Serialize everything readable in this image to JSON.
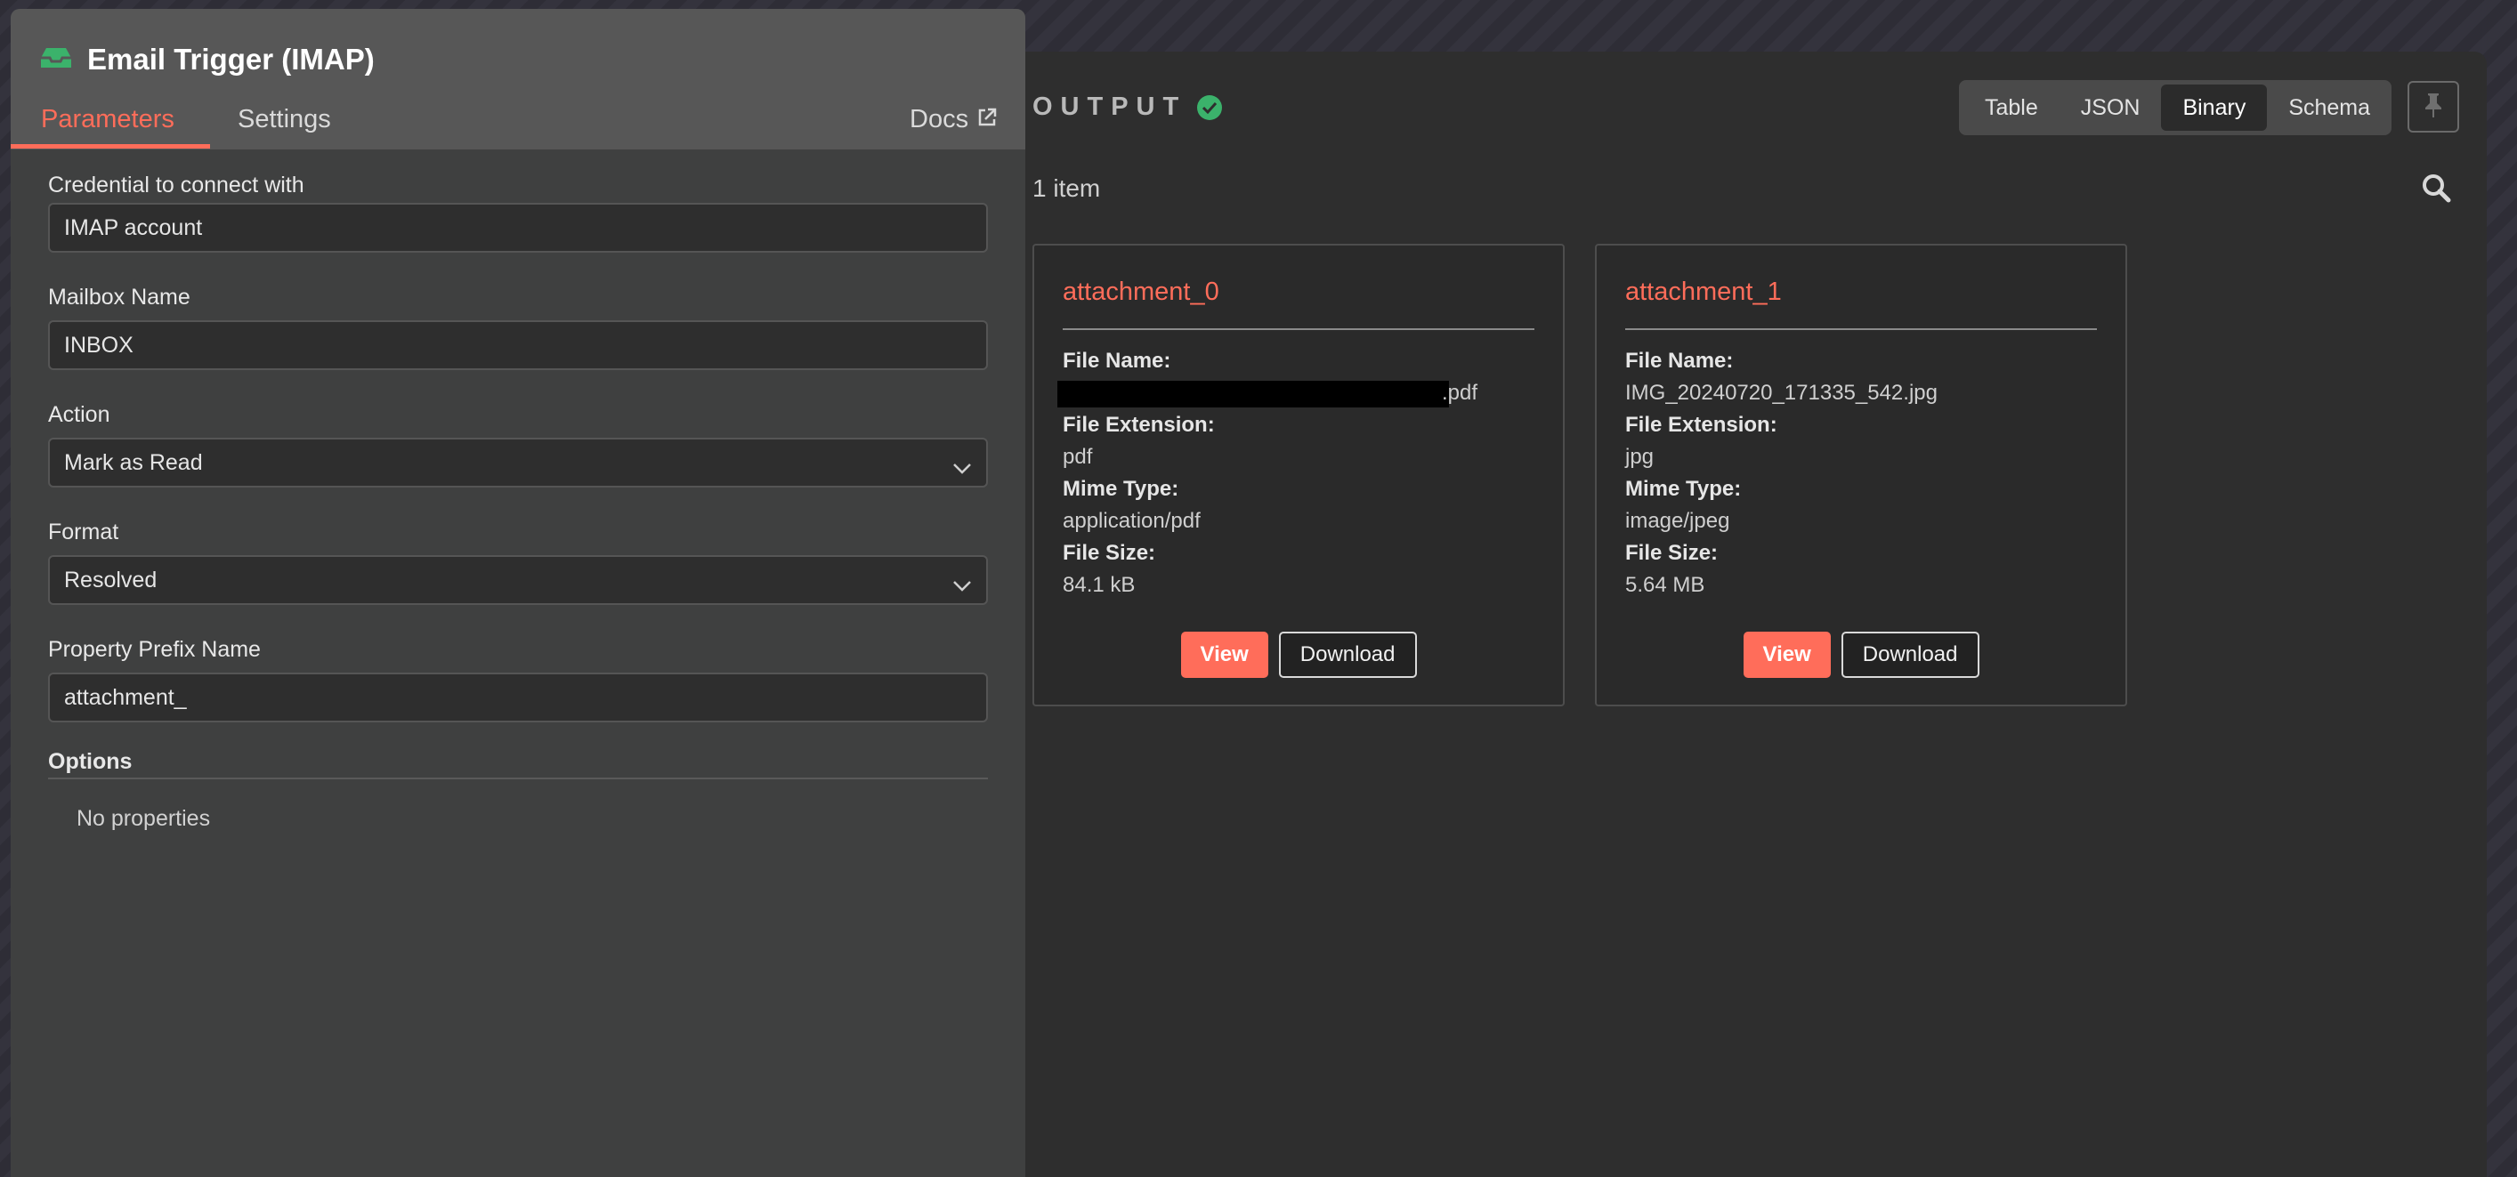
{
  "node": {
    "title": "Email Trigger (IMAP)",
    "tabs": [
      "Parameters",
      "Settings"
    ],
    "docs_label": "Docs",
    "icon": "inbox-icon",
    "fields": [
      {
        "label": "Credential to connect with",
        "value": "IMAP account"
      },
      {
        "label": "Mailbox Name",
        "value": "INBOX"
      },
      {
        "label": "Action",
        "value": "Mark as Read"
      },
      {
        "label": "Format",
        "value": "Resolved"
      },
      {
        "label": "Property Prefix Name",
        "value": "attachment_"
      }
    ],
    "options_label": "Options",
    "no_properties": "No properties"
  },
  "output": {
    "label": "OUTPUT",
    "view_tabs": [
      "Table",
      "JSON",
      "Binary",
      "Schema"
    ],
    "active_tab": "Binary",
    "item_count": "1 item",
    "labels": {
      "file_name": "File Name:",
      "file_extension": "File Extension:",
      "mime_type": "Mime Type:",
      "file_size": "File Size:",
      "view": "View",
      "download": "Download"
    },
    "cards": [
      {
        "title": "attachment_0",
        "file_name": ".pdf",
        "file_extension": "pdf",
        "mime_type": "application/pdf",
        "file_size": "84.1 kB"
      },
      {
        "title": "attachment_1",
        "file_name": "IMG_20240720_171335_542.jpg",
        "file_extension": "jpg",
        "mime_type": "image/jpeg",
        "file_size": "5.64 MB"
      }
    ]
  },
  "colors": {
    "accent": "#ff6d5a",
    "success": "#3bb26b"
  }
}
